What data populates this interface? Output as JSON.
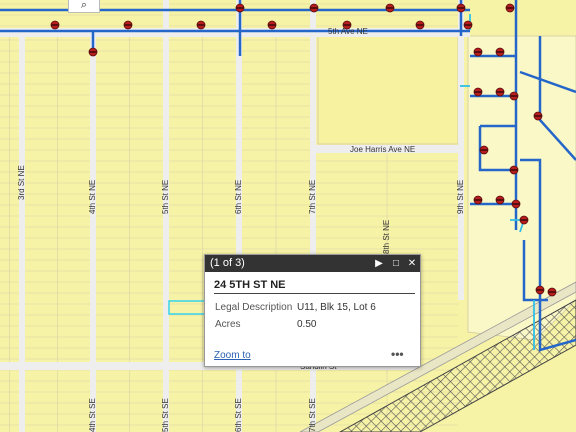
{
  "map": {
    "street_labels": {
      "ave_5th": "5th Ave NE",
      "joe_harris": "Joe Harris Ave NE",
      "st_3rd": "3rd St NE",
      "st_4th": "4th St NE",
      "st_5th": "5th St NE",
      "st_6th": "6th St NE",
      "st_7th": "7th St NE",
      "st_8th": "8th St NE",
      "st_9th": "9th St NE",
      "sandlin": "Sandlin St",
      "st_4th_se": "4th St SE",
      "st_5th_se": "5th St SE",
      "st_6th_se": "6th St SE",
      "st_7th_se": "7th St SE"
    },
    "colors": {
      "parcel": "#f7f3a6",
      "parcel_line": "#cfc9a2",
      "road": "#eeeeee",
      "water_main": "#2566c9",
      "service_line": "#2fc0e6",
      "selected_parcel": "#36d3ee",
      "hydrant": "#b81d1d",
      "rail_hatch": "#555555"
    }
  },
  "popup": {
    "counter": "(1 of 3)",
    "title": "24 5TH ST NE",
    "attributes": [
      {
        "label": "Legal Description",
        "value": "U11, Blk 15, Lot 6"
      },
      {
        "label": "Acres",
        "value": "0.50"
      }
    ],
    "zoom_link": "Zoom to",
    "more": "•••",
    "next_icon": "▶",
    "maximize_icon": "□",
    "close_icon": "✕"
  },
  "search": {
    "icon": "⌕"
  }
}
